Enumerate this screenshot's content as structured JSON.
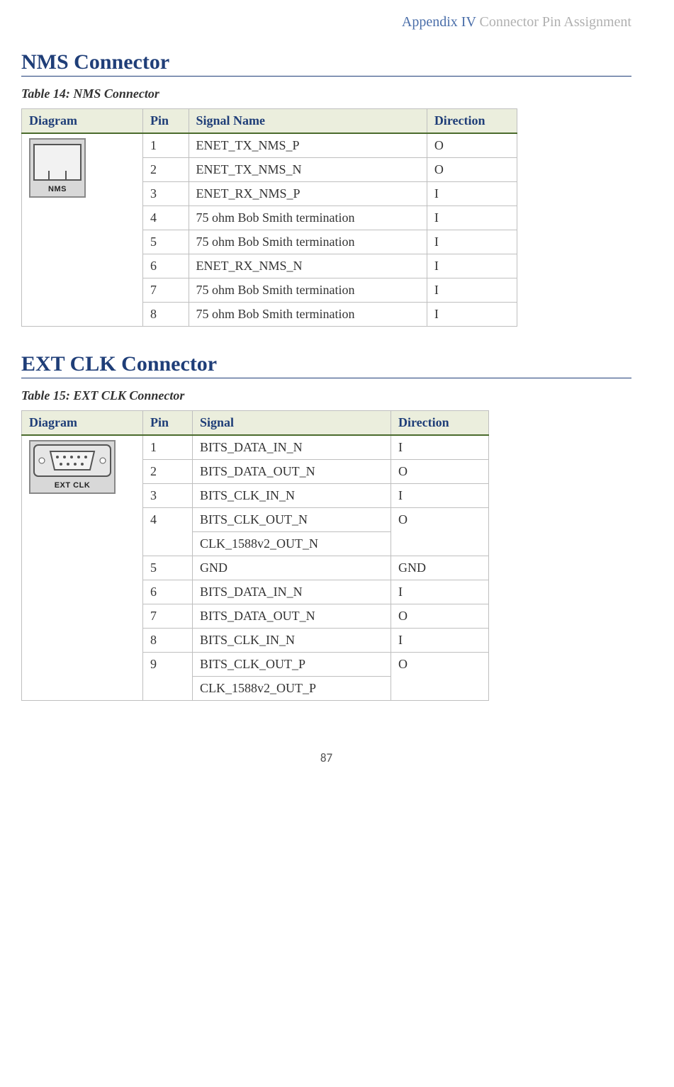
{
  "header": {
    "appendix": "Appendix IV",
    "title": "Connector Pin Assignment"
  },
  "section1": {
    "heading": "NMS Connector",
    "caption": "Table 14:   NMS Connector",
    "diagram_label": "NMS",
    "columns": {
      "c1": "Diagram",
      "c2": "Pin",
      "c3": "Signal Name",
      "c4": "Direction"
    },
    "rows": [
      {
        "pin": "1",
        "signal": "ENET_TX_NMS_P",
        "dir": "O"
      },
      {
        "pin": "2",
        "signal": "ENET_TX_NMS_N",
        "dir": "O"
      },
      {
        "pin": "3",
        "signal": "ENET_RX_NMS_P",
        "dir": "I"
      },
      {
        "pin": "4",
        "signal": "75 ohm Bob Smith termination",
        "dir": "I"
      },
      {
        "pin": "5",
        "signal": "75 ohm Bob Smith termination",
        "dir": "I"
      },
      {
        "pin": "6",
        "signal": "ENET_RX_NMS_N",
        "dir": "I"
      },
      {
        "pin": "7",
        "signal": "75 ohm Bob Smith termination",
        "dir": "I"
      },
      {
        "pin": "8",
        "signal": "75 ohm Bob Smith termination",
        "dir": "I"
      }
    ]
  },
  "section2": {
    "heading": "EXT CLK Connector",
    "caption": "Table 15:   EXT CLK Connector",
    "diagram_label": "EXT CLK",
    "columns": {
      "c1": "Diagram",
      "c2": "Pin",
      "c3": "Signal",
      "c4": "Direction"
    },
    "rows": [
      {
        "pin": "1",
        "signal": "BITS_DATA_IN_N",
        "dir": "I"
      },
      {
        "pin": "2",
        "signal": "BITS_DATA_OUT_N",
        "dir": "O"
      },
      {
        "pin": "3",
        "signal": "BITS_CLK_IN_N",
        "dir": "I"
      },
      {
        "pin": "4",
        "signal": "BITS_CLK_OUT_N",
        "dir": "O",
        "signal2": "CLK_1588v2_OUT_N"
      },
      {
        "pin": "5",
        "signal": "GND",
        "dir": "GND"
      },
      {
        "pin": "6",
        "signal": "BITS_DATA_IN_N",
        "dir": "I"
      },
      {
        "pin": "7",
        "signal": "BITS_DATA_OUT_N",
        "dir": "O"
      },
      {
        "pin": "8",
        "signal": "BITS_CLK_IN_N",
        "dir": "I"
      },
      {
        "pin": "9",
        "signal": "BITS_CLK_OUT_P",
        "dir": "O",
        "signal2": "CLK_1588v2_OUT_P"
      }
    ]
  },
  "page_number": "87"
}
